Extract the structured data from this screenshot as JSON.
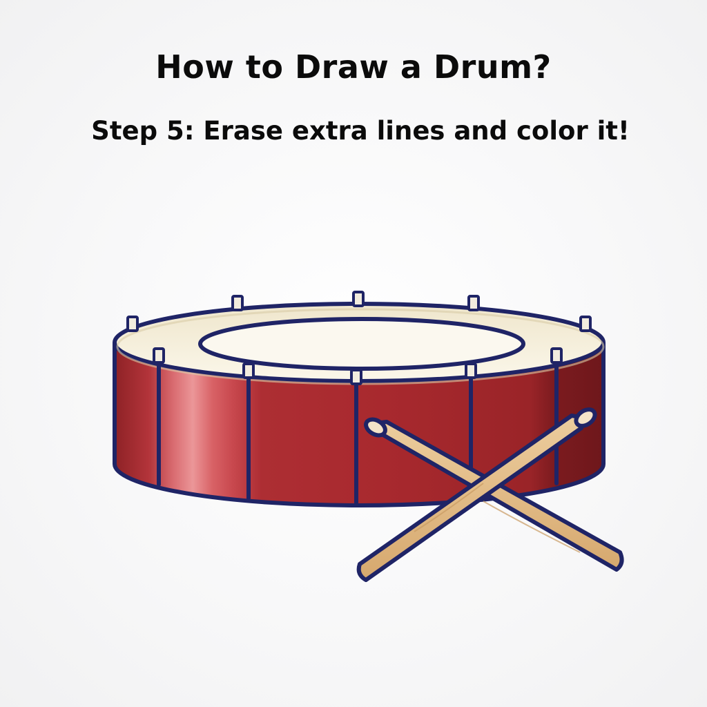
{
  "header": {
    "title": "How to Draw a Drum?",
    "step": "Step 5: Erase extra lines and color it!"
  },
  "illustration": {
    "subject": "drum-with-crossed-drumsticks",
    "colors": {
      "shell": "#a3282c",
      "shell_highlight": "#e58a8c",
      "drumhead": "#f7f0dd",
      "outline": "#1f2466",
      "stick": "#e2bd8a",
      "background": "#f6f6f7"
    }
  }
}
